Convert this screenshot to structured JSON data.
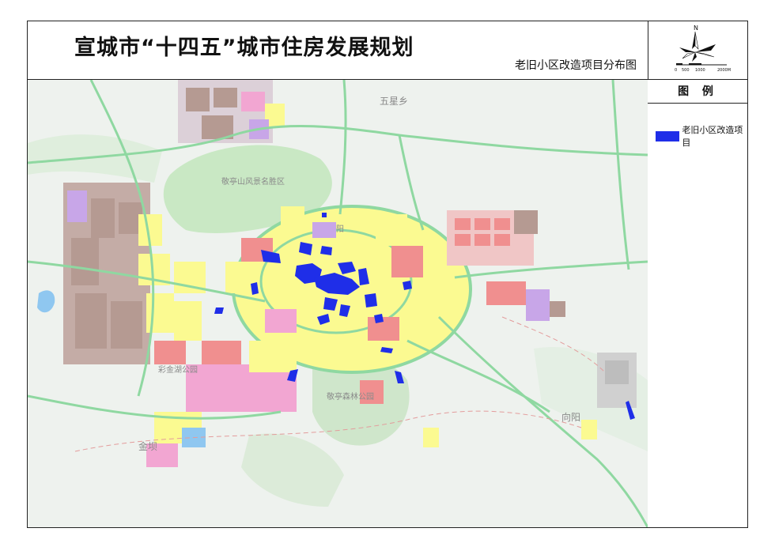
{
  "title": "宣城市“十四五”城市住房发展规划",
  "subtitle": "老旧小区改造项目分布图",
  "compass": {
    "north_label": "N",
    "scale_labels": [
      "0",
      "500",
      "1000",
      "2000M"
    ]
  },
  "legend": {
    "heading": "图  例",
    "items": [
      {
        "label": "老旧小区改造项目",
        "color": "#1f2ee8"
      }
    ]
  },
  "place_labels": {
    "wuxing": "五星乡",
    "jingting": "敬亭山风景名胜区",
    "yanhu": "彩金湖公园",
    "forest": "敬亭森林公园",
    "xiangyang": "向阳",
    "jinba": "金坝",
    "yang": "阳"
  },
  "colors": {
    "renovation": "#1f2ee8",
    "residential": "#fbfa91",
    "commercial": "#f08f8f",
    "industrial": "#b59a92",
    "green": "#c9e8c4",
    "road": "#8fd8a1",
    "public": "#f2a6d2",
    "education": "#c8a6e8",
    "water": "#8fc7f0"
  }
}
